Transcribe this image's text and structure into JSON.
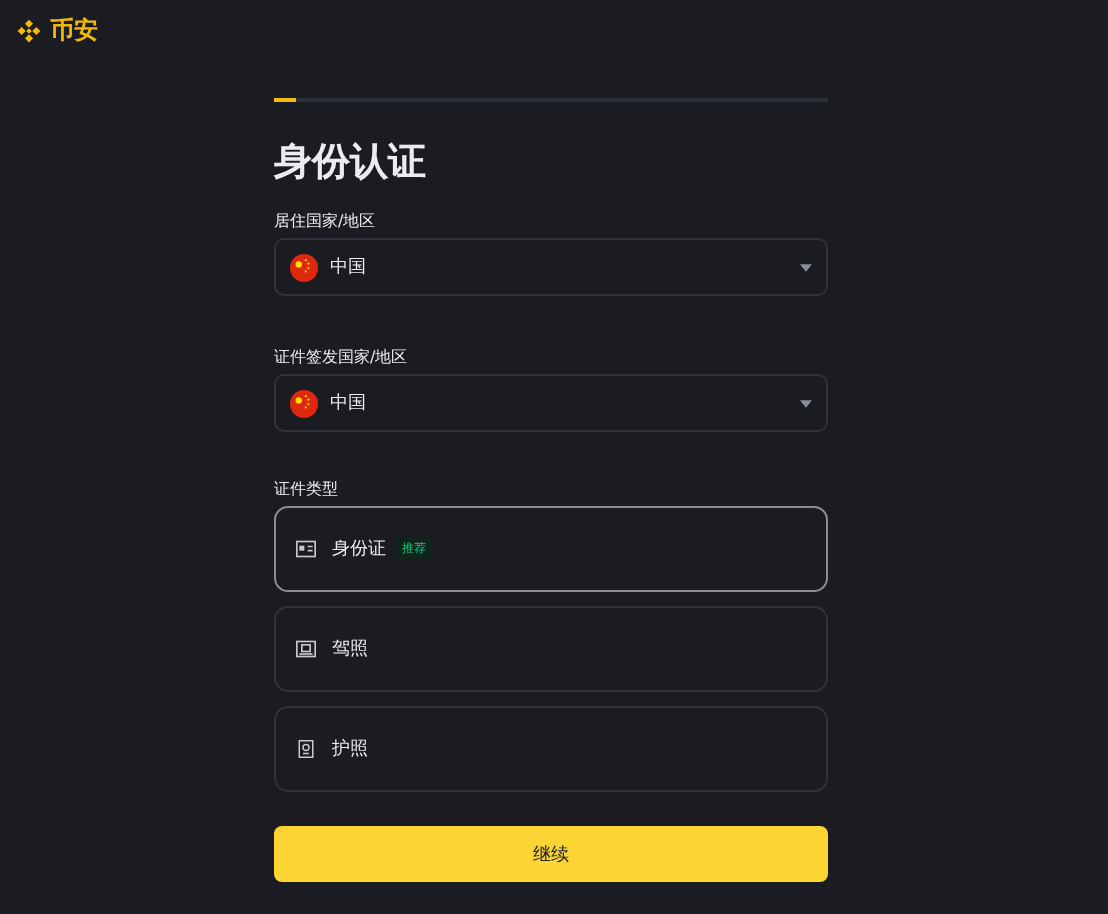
{
  "brand": {
    "name": "币安"
  },
  "progress": {
    "level": 0.04
  },
  "title": "身份认证",
  "fields": [
    {
      "label": "居住国家/地区",
      "value": "中国"
    },
    {
      "label": "证件签发国家/地区",
      "value": "中国"
    }
  ],
  "document_type": {
    "label": "证件类型",
    "options": [
      {
        "kind": "id",
        "label": "身份证",
        "badge": "推荐",
        "selected": true
      },
      {
        "kind": "license",
        "label": "驾照",
        "selected": false
      },
      {
        "kind": "passport",
        "label": "护照",
        "selected": false
      }
    ]
  },
  "continue_button": "继续"
}
